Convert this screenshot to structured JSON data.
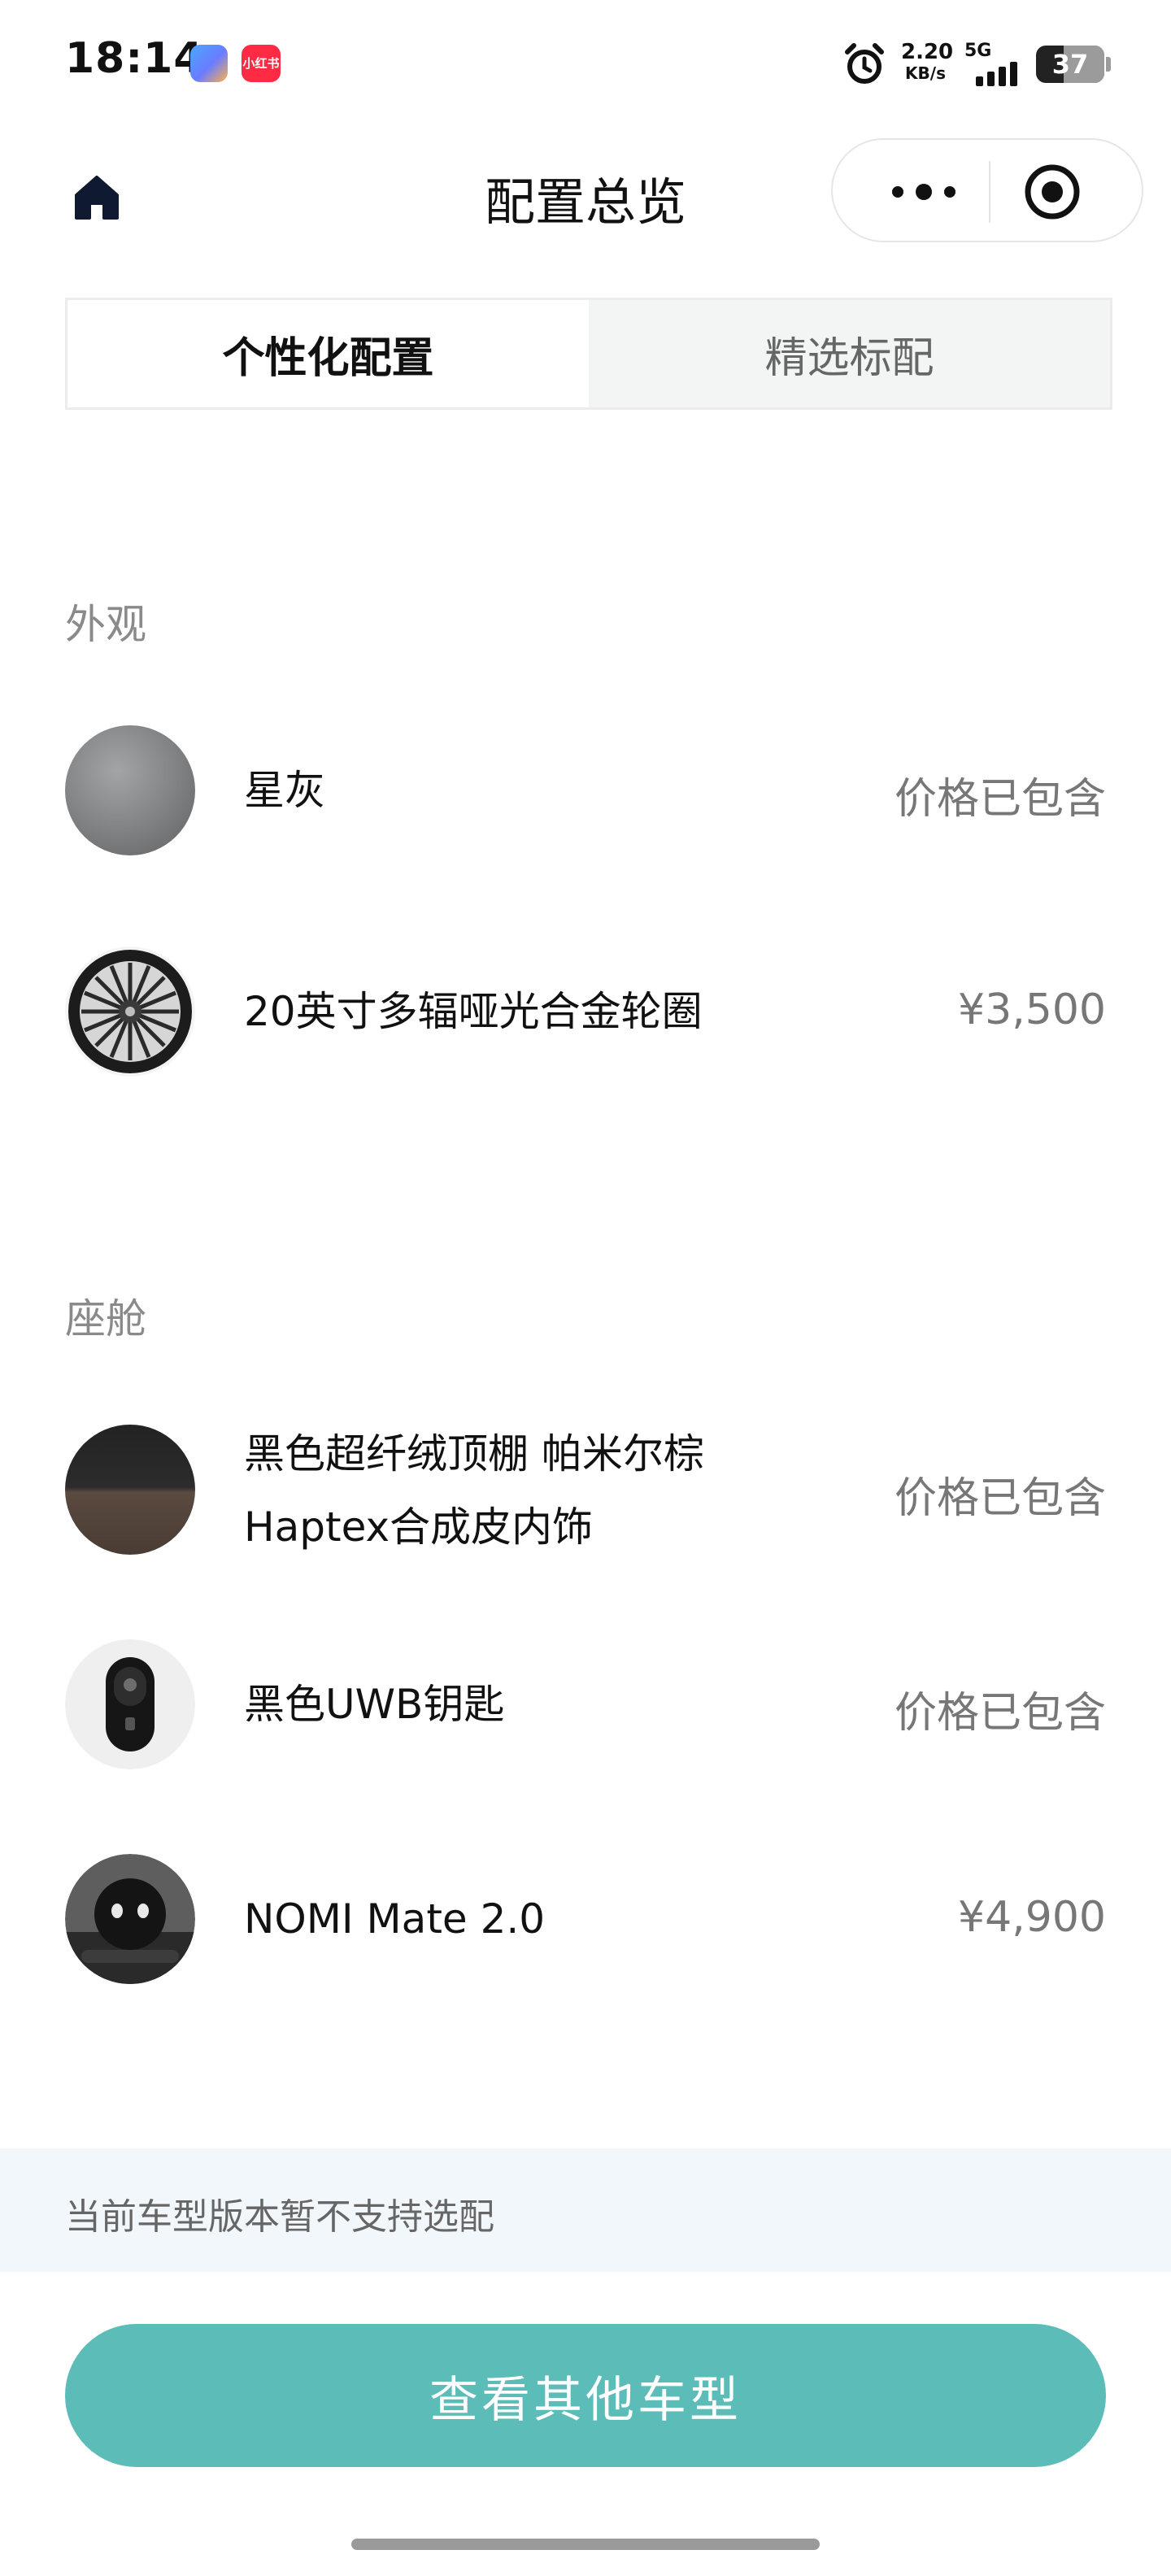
{
  "status_bar": {
    "time": "18:14",
    "app_badge_text": "小红书",
    "net_speed_value": "2.20",
    "net_speed_unit": "KB/s",
    "network": "5G",
    "battery": "37"
  },
  "header": {
    "title": "配置总览"
  },
  "tabs": [
    {
      "label": "个性化配置",
      "active": true
    },
    {
      "label": "精选标配",
      "active": false
    }
  ],
  "sections": {
    "exterior": {
      "title": "外观",
      "items": [
        {
          "name": "星灰",
          "price": "价格已包含",
          "icon": "color-swatch"
        },
        {
          "name": "20英寸多辐哑光合金轮圈",
          "price": "¥3,500",
          "icon": "wheel"
        }
      ]
    },
    "cabin": {
      "title": "座舱",
      "items": [
        {
          "name_line1": "黑色超纤绒顶棚 帕米尔棕",
          "name_line2": "Haptex合成皮内饰",
          "price": "价格已包含",
          "icon": "interior-material"
        },
        {
          "name": "黑色UWB钥匙",
          "price": "价格已包含",
          "icon": "car-key"
        },
        {
          "name": "NOMI Mate 2.0",
          "price": "¥4,900",
          "icon": "nomi-robot"
        }
      ]
    }
  },
  "notice": "当前车型版本暂不支持选配",
  "cta": {
    "label": "查看其他车型",
    "color": "#5bbcb8"
  },
  "colors": {
    "accent": "#5bbcb8",
    "swatch_star_grey": "#7f8082"
  }
}
